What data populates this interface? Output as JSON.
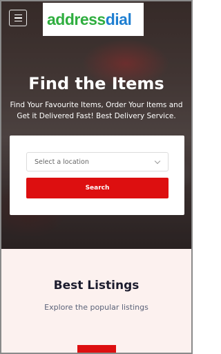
{
  "header": {
    "menu_icon": "hamburger-menu-icon",
    "logo_part_1": "address",
    "logo_part_2": "dial",
    "logo_colors": {
      "address": "#2fae3f",
      "dial": "#1f7fd1"
    }
  },
  "hero": {
    "title": "Find the Items",
    "subtitle": "Find Your Favourite Items, Order Your Items and Get it Delivered Fast! Best Delivery Service."
  },
  "search": {
    "location_placeholder": "Select a location",
    "button_label": "Search",
    "accent_color": "#dd0f10"
  },
  "listings": {
    "title": "Best Listings",
    "subtitle": "Explore the popular listings"
  }
}
